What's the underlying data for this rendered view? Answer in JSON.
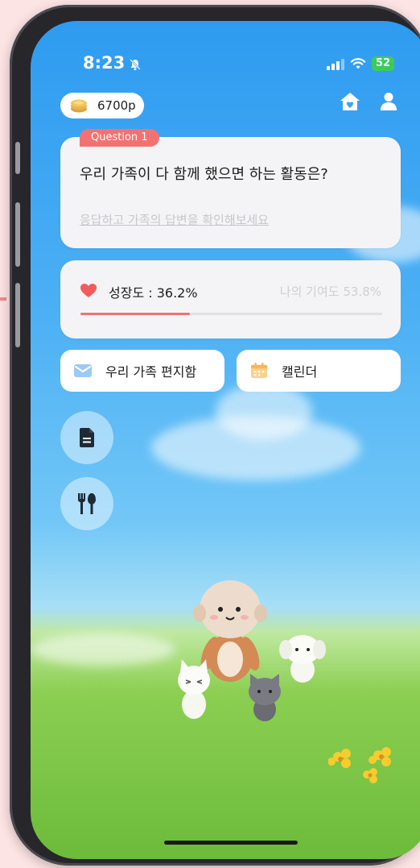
{
  "status_bar": {
    "time": "8:23",
    "battery": "52"
  },
  "header": {
    "points": "6700p"
  },
  "question_card": {
    "badge": "Question 1",
    "question": "우리 가족이 다 함께 했으면 하는 활동은?",
    "prompt_link": "응답하고 가족의 답변을 확인해보세요"
  },
  "growth_card": {
    "label": "성장도 : 36.2%",
    "contribution": "나의 기여도 53.8%",
    "progress": 0.362
  },
  "shortcuts": {
    "mailbox_label": "우리 가족 편지함",
    "calendar_label": "캘린더"
  },
  "icons": [
    "coin-icon",
    "home-icon",
    "user-icon",
    "heart-icon",
    "mail-icon",
    "calendar-icon",
    "document-icon",
    "utensils-icon"
  ],
  "colors": {
    "accent": "#f27272",
    "sky": "#4cb0f4",
    "grass": "#7cc646"
  }
}
